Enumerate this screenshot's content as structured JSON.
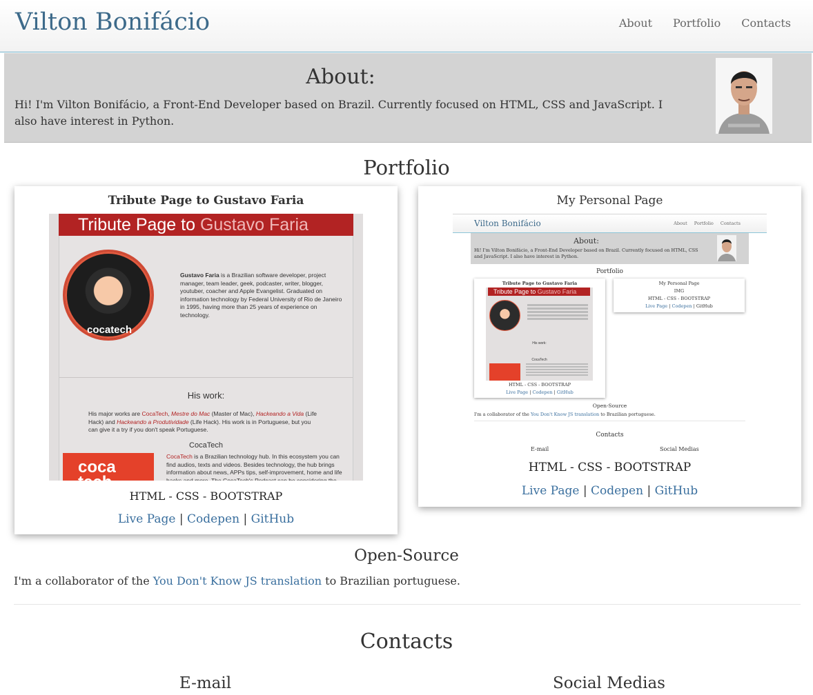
{
  "navbar": {
    "brand": "Vilton Bonifácio",
    "links": [
      "About",
      "Portfolio",
      "Contacts"
    ]
  },
  "about": {
    "title": "About:",
    "text": "Hi! I'm Vilton Bonifácio, a Front-End Developer based on Brazil. Currently focused on HTML, CSS and JavaScript. I also have interest in Python.",
    "photo_icon": "profile-photo"
  },
  "portfolio": {
    "title": "Portfolio",
    "cards": [
      {
        "title": "Tribute Page to Gustavo Faria",
        "tech": "HTML - CSS - BOOTSTRAP",
        "links": [
          "Live Page",
          "Codepen",
          "GitHub"
        ],
        "separator": "|",
        "preview": {
          "banner_a": "Tribute Page to ",
          "banner_b": "Gustavo Faria",
          "bio_name": "Gustavo Faria",
          "bio_rest": " is a Brazilian software developer, project manager, team leader, geek, podcaster, writer, blogger, youtuber, coacher and Apple Evangelist. Graduated on information technology by Federal University of Rio de Janeiro in 1995, having more than 25 years of experience on technology.",
          "work_title": "His work:",
          "work_p1": "His major works are ",
          "work_l1": "CocaTech",
          "work_sep1": ", ",
          "work_l2": "Mestre do Mac",
          "work_p2": " (Master of Mac), ",
          "work_l3": "Hackeando a Vida",
          "work_p3": " (Life Hack) and ",
          "work_l4": "Hackeando a Produtividade",
          "work_p4": " (Life Hack). His work is in Portuguese, but you can give it a try if you don't speak Portuguese.",
          "coca_title": "CocaTech",
          "coca_link": "CocaTech",
          "coca_text": " is a Brazilian technology hub. In this ecosystem you can find audios, texts and videos. Besides technology, the hub brings information about news, APPs tips, self-improvement, home and life hacks and more. The CocaTech's Podcast can be considering the icing on the cake. On its seventh season and delivered tree times per day (awesome!), the podcast is a good companion for your daily routine.",
          "coca_logo_1": "coca",
          "coca_logo_2": "tech",
          "shirt_text": "cocatech"
        }
      },
      {
        "title": "My Personal Page",
        "tech": "HTML - CSS - BOOTSTRAP",
        "links": [
          "Live Page",
          "Codepen",
          "GitHub"
        ],
        "separator": "|",
        "preview": {
          "brand": "Vilton Bonifácio",
          "nav": [
            "About",
            "Portfolio",
            "Contacts"
          ],
          "about_title": "About:",
          "about_text": "Hi! I'm Vilton Bonifácio, a Front-End Developer based on Brazil. Currently focused on HTML, CSS and JavaScript. I also have interest in Python.",
          "portfolio_title": "Portfolio",
          "card1_title": "Tribute Page to Gustavo Faria",
          "card1_banner_a": "Tribute Page to ",
          "card1_banner_b": "Gustavo Faria",
          "card1_work": "His work:",
          "card1_coca": "CocaTech",
          "card1_tech": "HTML - CSS - BOOTSTRAP",
          "card2_title": "My Personal Page",
          "card2_img": "IMG",
          "card2_tech": "HTML - CSS - BOOTSTRAP",
          "links": [
            "Live Page",
            "Codepen",
            "GitHub"
          ],
          "separator": "|",
          "os_title": "Open-Source",
          "os_text_a": "I'm a collaborator of the ",
          "os_link": "You Don't Know JS translation",
          "os_text_b": " to Brazilian portuguese.",
          "contacts_title": "Contacts",
          "email": "E-mail",
          "social": "Social Medias"
        }
      }
    ]
  },
  "open_source": {
    "title": "Open-Source",
    "text_before": "I'm a collaborator of the ",
    "link": "You Don't Know JS translation",
    "text_after": " to Brazilian portuguese."
  },
  "contacts": {
    "title": "Contacts",
    "email_title": "E-mail",
    "social_title": "Social Medias"
  },
  "colors": {
    "brand": "#3d6a8a",
    "link": "#3a6f9e",
    "about_bg": "#d3d3d3",
    "tribute_red": "#b22323"
  }
}
